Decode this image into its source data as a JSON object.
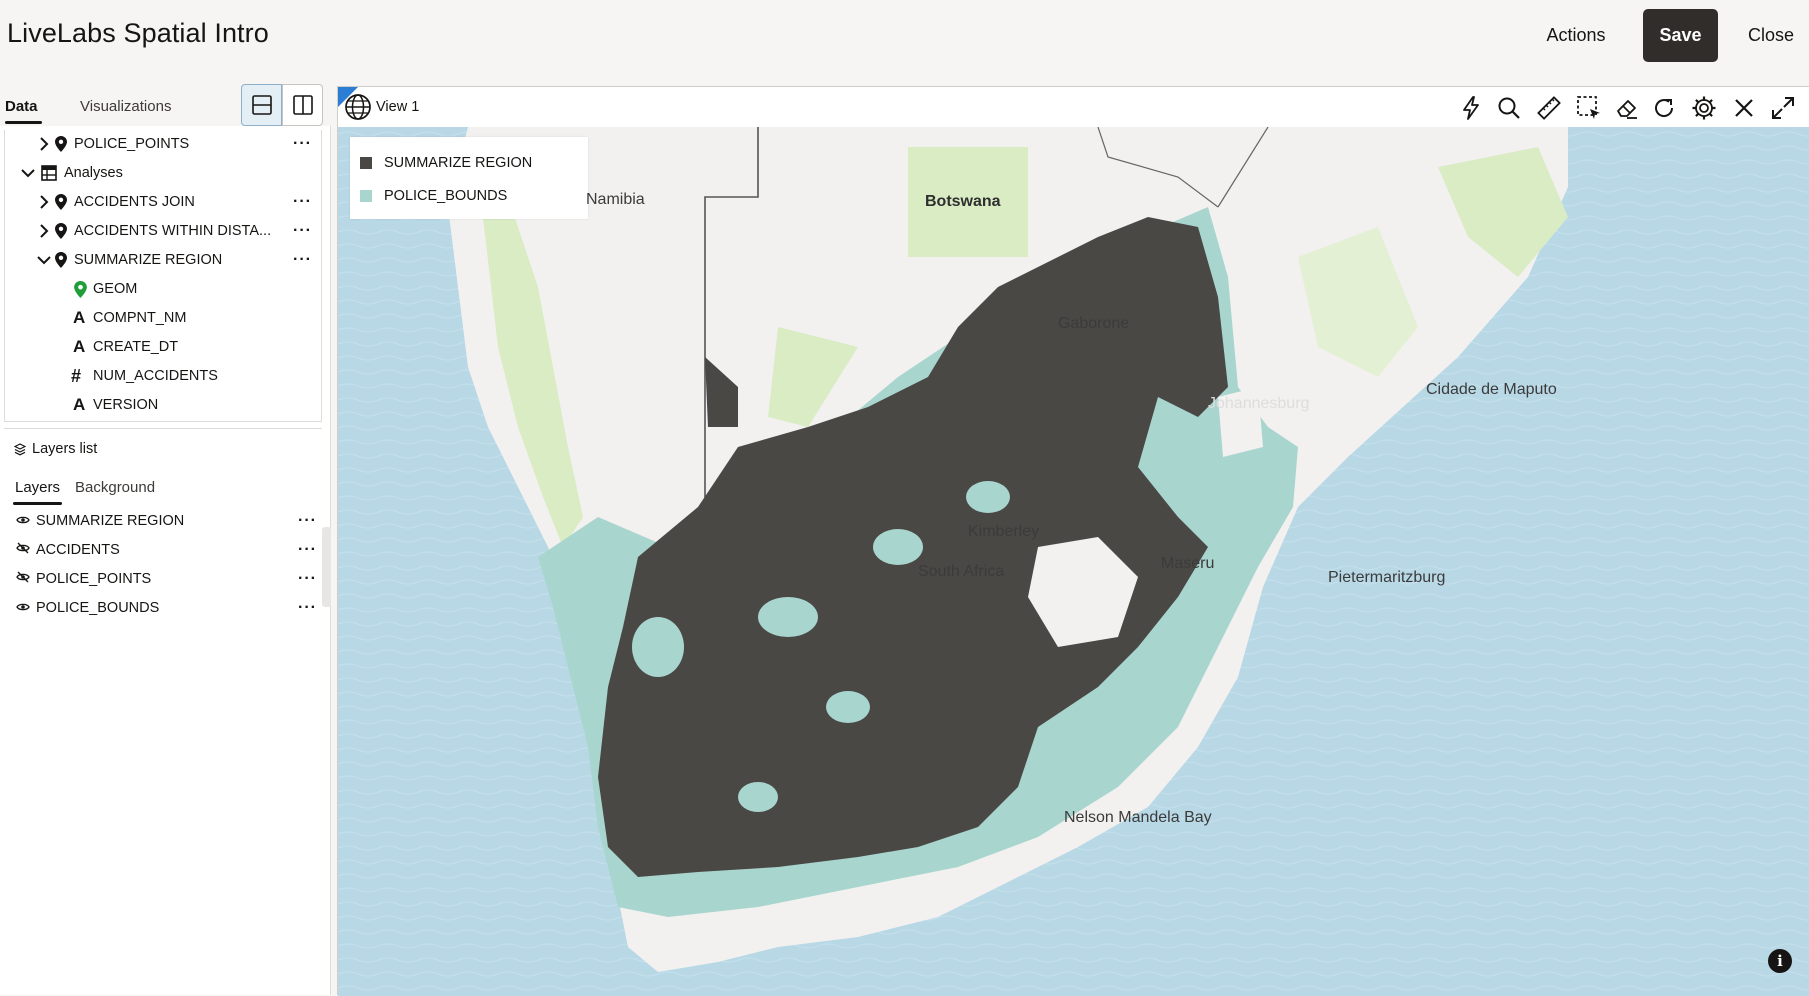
{
  "header": {
    "title": "LiveLabs Spatial Intro",
    "actions_label": "Actions",
    "save_label": "Save",
    "close_label": "Close"
  },
  "left_tabs": {
    "data": "Data",
    "visualizations": "Visualizations"
  },
  "tree": {
    "items": [
      {
        "label": "POLICE_POINTS",
        "icon": "location-pin-icon",
        "expander": "chevron-right-icon",
        "has_menu": true
      },
      {
        "label": "Analyses",
        "icon": "table-icon",
        "expander": "chevron-down-icon",
        "has_menu": false
      },
      {
        "label": "ACCIDENTS JOIN",
        "icon": "location-pin-icon",
        "expander": "chevron-right-icon",
        "has_menu": true
      },
      {
        "label": "ACCIDENTS WITHIN DISTA...",
        "icon": "location-pin-icon",
        "expander": "chevron-right-icon",
        "has_menu": true
      },
      {
        "label": "SUMMARIZE REGION",
        "icon": "location-pin-icon",
        "expander": "chevron-down-icon",
        "has_menu": true
      },
      {
        "label": "GEOM",
        "icon": "geometry-pin-icon"
      },
      {
        "label": "COMPNT_NM",
        "icon": "text-type-icon"
      },
      {
        "label": "CREATE_DT",
        "icon": "text-type-icon"
      },
      {
        "label": "NUM_ACCIDENTS",
        "icon": "number-type-icon"
      },
      {
        "label": "VERSION",
        "icon": "text-type-icon"
      }
    ]
  },
  "layers_panel": {
    "title": "Layers list",
    "tab_layers": "Layers",
    "tab_background": "Background",
    "layers": [
      {
        "label": "SUMMARIZE REGION",
        "visible": true
      },
      {
        "label": "ACCIDENTS",
        "visible": false
      },
      {
        "label": "POLICE_POINTS",
        "visible": false
      },
      {
        "label": "POLICE_BOUNDS",
        "visible": true
      }
    ]
  },
  "view": {
    "title": "View 1",
    "tools": [
      "lightning-icon",
      "search-icon",
      "ruler-icon",
      "select-region-icon",
      "eraser-icon",
      "refresh-icon",
      "gear-icon",
      "close-icon",
      "expand-icon"
    ]
  },
  "map": {
    "legend": [
      {
        "label": "SUMMARIZE REGION",
        "color": "#4a4845"
      },
      {
        "label": "POLICE_BOUNDS",
        "color": "#a9d5cf"
      }
    ],
    "place_labels": {
      "namibia": "Namibia",
      "botswana": "Botswana",
      "gaborone": "Gaborone",
      "maputo": "Cidade de Maputo",
      "maseru": "Maseru",
      "kimberley": "Kimberley",
      "south_africa": "South Africa",
      "maritzburg": "Pietermaritzburg",
      "nelson_mandela_bay": "Nelson Mandela Bay",
      "joburg": "Johannesburg"
    },
    "colors": {
      "water": "#b8d8e6",
      "land": "#f2f1ef",
      "park": "#d9ecc4",
      "region": "#4a4845",
      "bounds": "#a9d5cf"
    }
  }
}
